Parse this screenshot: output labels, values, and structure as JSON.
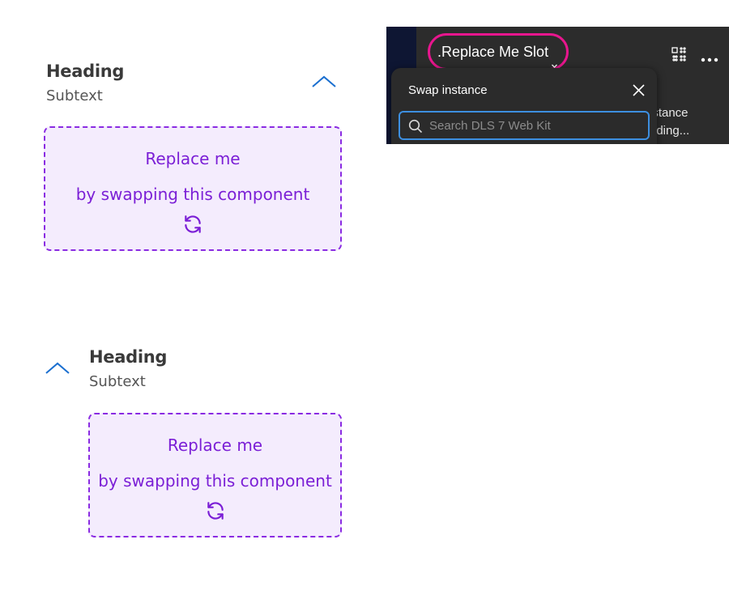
{
  "accordion_top": {
    "heading": "Heading",
    "subtext": "Subtext",
    "slot": {
      "line1": "Replace me",
      "line2": "by swapping this component"
    }
  },
  "accordion_bottom": {
    "heading": "Heading",
    "subtext": "Subtext",
    "slot": {
      "line1": "Replace me",
      "line2": "by swapping this component"
    }
  },
  "editor": {
    "component_name": ".Replace Me Slot",
    "behind_text_1": "istance",
    "behind_text_2": "uding...",
    "swap_popup": {
      "title": "Swap instance",
      "search_placeholder": "Search DLS 7 Web Kit"
    }
  },
  "icons": {
    "chevron": "chevron-up-icon",
    "swap": "refresh-icon",
    "caret": "chevron-down-icon",
    "grid": "component-grid-icon",
    "more": "more-horizontal-icon",
    "close": "close-icon",
    "search": "search-icon"
  },
  "colors": {
    "chevron": "#1a6fd0",
    "slot_fill": "#f4ecfd",
    "slot_border": "#8a2be2",
    "slot_text": "#7b1fd6",
    "highlight": "#e8168e",
    "focus": "#3d8fe0",
    "panel": "#2c2c2c"
  }
}
